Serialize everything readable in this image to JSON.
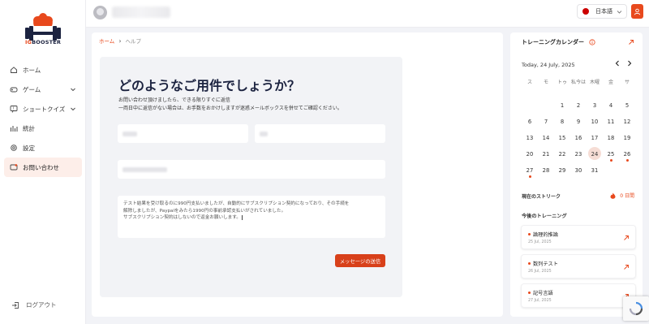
{
  "brand": {
    "logo_text_ig": "IG",
    "logo_text_rest": "BOOSTER",
    "accent": "#e8491d"
  },
  "sidebar": {
    "items": [
      {
        "label": "ホーム",
        "icon": "home-icon"
      },
      {
        "label": "ゲーム",
        "icon": "gamepad-icon"
      },
      {
        "label": "ショートクイズ",
        "icon": "quiz-icon"
      },
      {
        "label": "統計",
        "icon": "stats-icon"
      },
      {
        "label": "設定",
        "icon": "gear-icon"
      },
      {
        "label": "お問い合わせ",
        "icon": "contact-icon",
        "active": true
      }
    ],
    "logout": "ログアウト"
  },
  "topbar": {
    "language": "日本語"
  },
  "breadcrumb": {
    "home": "ホーム",
    "current": "ヘルプ"
  },
  "contact": {
    "title": "どのようなご用件でしょうか？",
    "desc_line1": "お問い合わせ頂けましたら、できる限りすぐに返信",
    "desc_line2": "一両日中に返信がない場合は、お手数をおかけしますが迷惑メールボックスを併せてご確認ください。",
    "message_lines": [
      "テスト結果を受け取るのに990円支払いましたが、自動的にサブスクリプション契約になっており、その手続を",
      "解除しましたが、Paypalをみたら1990円の事前承認支払いがされていました。",
      "サブスクリプション契約はしないので返金お願いします。"
    ],
    "submit_label": "メッセージの送信"
  },
  "calendar": {
    "title": "トレーニングカレンダー",
    "current_date": "Today, 24 July, 2025",
    "weekdays": [
      "ス",
      "モ",
      "トゥ",
      "私今は",
      "木曜",
      "金",
      "サ"
    ],
    "weeks": [
      [
        "",
        "",
        "1",
        "2",
        "3",
        "4",
        "5"
      ],
      [
        "6",
        "7",
        "8",
        "9",
        "10",
        "11",
        "12"
      ],
      [
        "13",
        "14",
        "15",
        "16",
        "17",
        "18",
        "19"
      ],
      [
        "20",
        "21",
        "22",
        "23",
        "24",
        "25",
        "26"
      ],
      [
        "27",
        "28",
        "29",
        "30",
        "31",
        "",
        ""
      ]
    ],
    "today": "24",
    "marked_days": [
      "25",
      "26",
      "27"
    ]
  },
  "streak": {
    "label": "現在のストリーク",
    "value": "0 日間"
  },
  "upcoming": {
    "title": "今後のトレーニング",
    "items": [
      {
        "name": "論理的推論",
        "date": "25 Jul, 2025"
      },
      {
        "name": "数列テスト",
        "date": "26 Jul, 2025"
      },
      {
        "name": "記号言語",
        "date": "27 Jul, 2025"
      }
    ]
  }
}
